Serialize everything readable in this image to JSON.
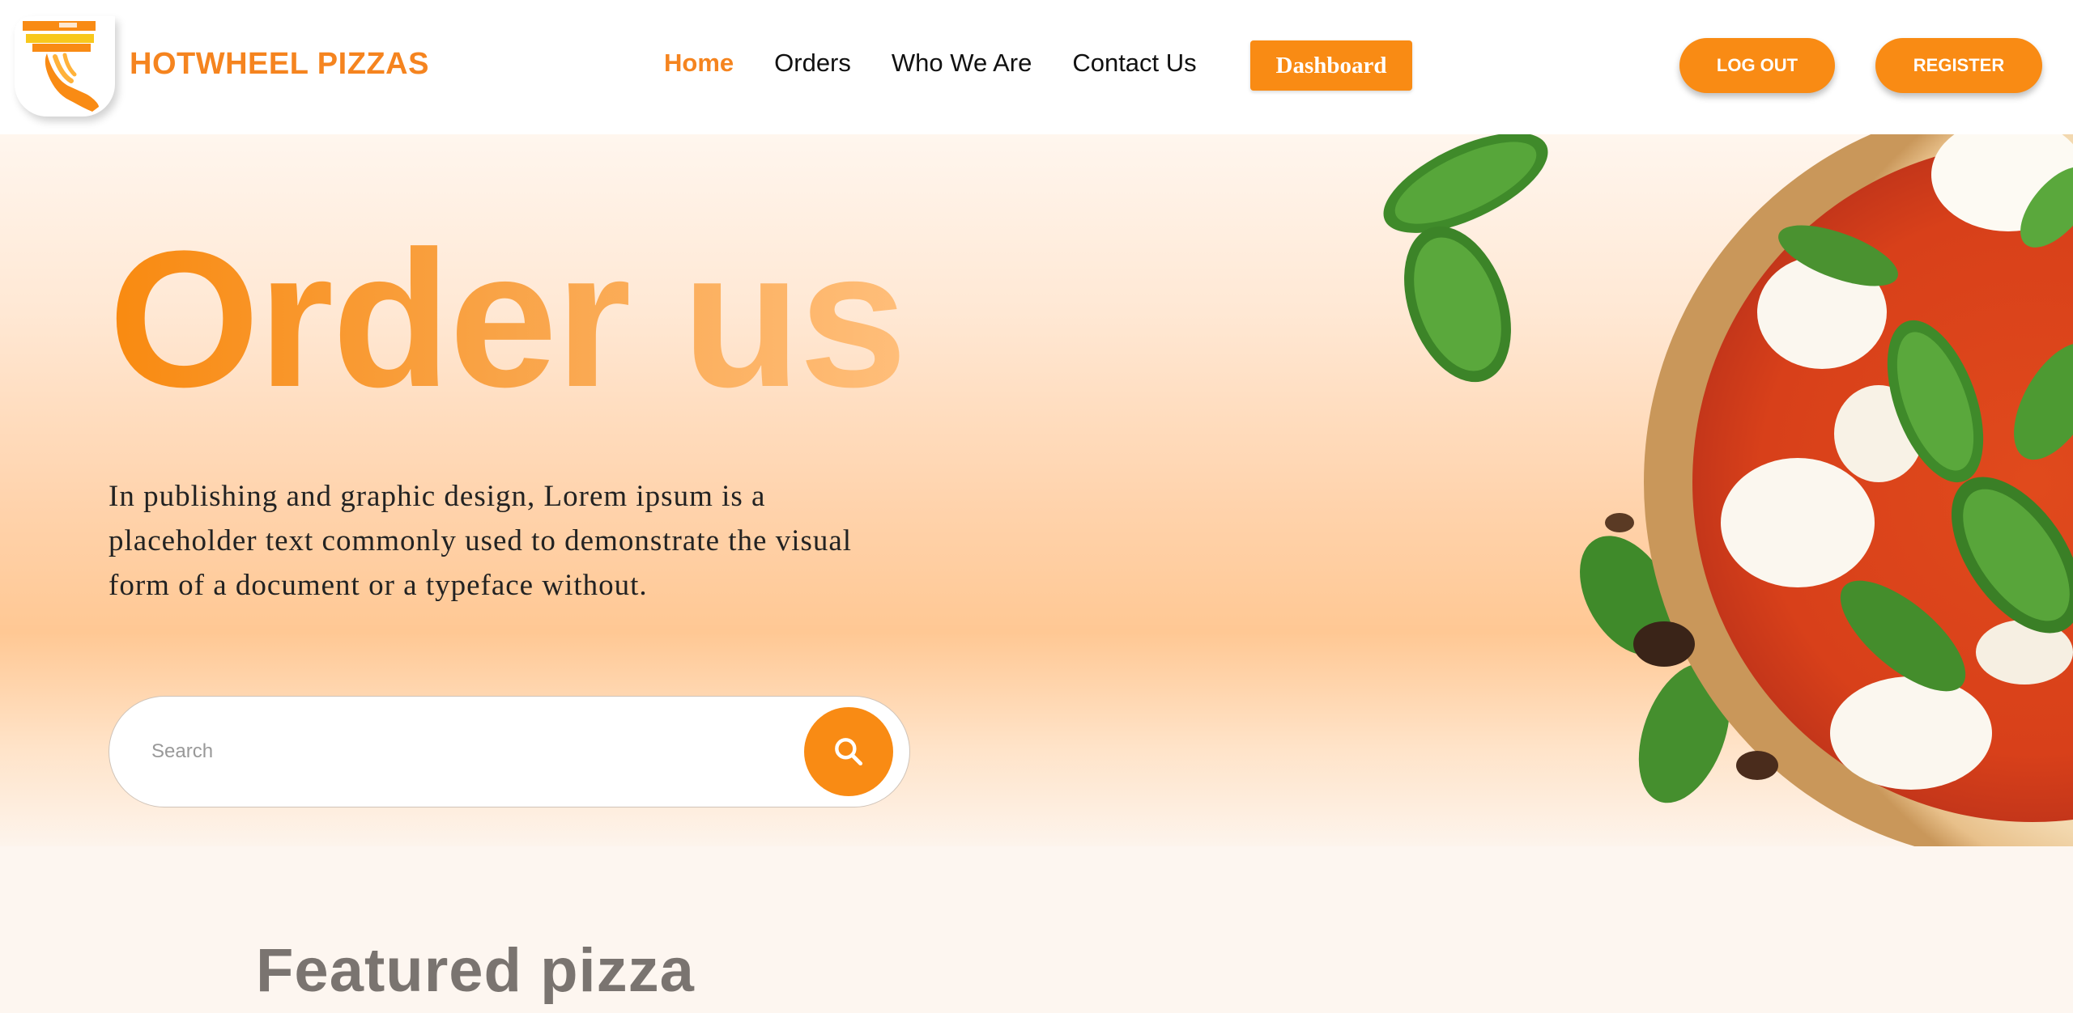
{
  "brand": {
    "name": "HOTWHEEL PIZZAS",
    "logo_icon": "pizza-delivery-hand-icon",
    "accent_color": "#f98b14"
  },
  "nav": {
    "items": [
      {
        "label": "Home",
        "active": true
      },
      {
        "label": "Orders",
        "active": false
      },
      {
        "label": "Who We Are",
        "active": false
      },
      {
        "label": "Contact Us",
        "active": false
      }
    ],
    "dashboard_label": "Dashboard"
  },
  "auth": {
    "logout_label": "LOG OUT",
    "register_label": "REGISTER"
  },
  "hero": {
    "title": "Order us",
    "description": "In publishing and graphic design, Lorem ipsum is a placeholder text commonly used to demonstrate the visual form of a document or a typeface without.",
    "image": "margherita-pizza-with-basil-icon"
  },
  "search": {
    "placeholder": "Search",
    "value": "",
    "button_icon": "search-icon"
  },
  "featured": {
    "heading": "Featured pizza"
  }
}
